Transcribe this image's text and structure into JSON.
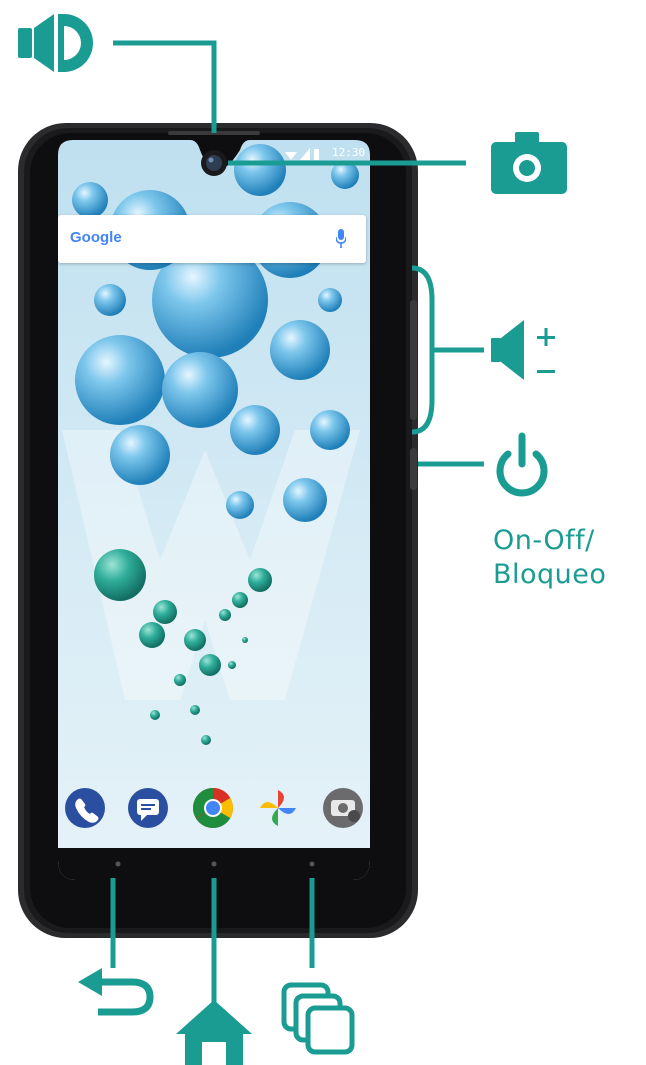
{
  "labels": {
    "power_line1": "On-Off/",
    "power_line2": "Bloqueo"
  },
  "screen": {
    "search_brand": "Google",
    "status_time": "12:30"
  },
  "icons": {
    "speaker": "speaker-icon",
    "camera": "camera-icon",
    "volume": "volume-plus-minus-icon",
    "power": "power-icon",
    "back": "back-icon",
    "home": "home-icon",
    "recents": "recents-icon",
    "dock": [
      "phone-app-icon",
      "messages-app-icon",
      "chrome-app-icon",
      "photos-app-icon",
      "camera-app-icon"
    ]
  },
  "colors": {
    "accent": "#1a9c93",
    "phone_frame": "#2b2b2d",
    "wallpaper": "#cfe6f2"
  }
}
